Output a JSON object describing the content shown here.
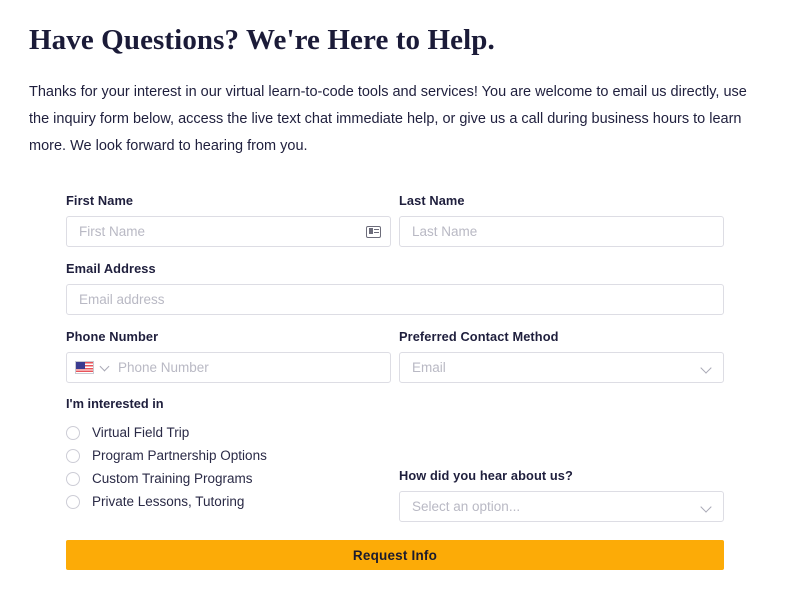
{
  "intro": {
    "title": "Have Questions? We're Here to Help.",
    "paragraph": "Thanks for your interest in our virtual learn-to-code tools and services! You are welcome to email us directly, use the inquiry form below, access the live text chat immediate help, or give us a call during business hours to learn more. We look forward to hearing from you."
  },
  "form": {
    "first_name": {
      "label": "First Name",
      "placeholder": "First Name",
      "value": "",
      "icon": "contact-card-icon"
    },
    "last_name": {
      "label": "Last Name",
      "placeholder": "Last Name",
      "value": ""
    },
    "email": {
      "label": "Email Address",
      "placeholder": "Email address",
      "value": ""
    },
    "phone": {
      "label": "Phone Number",
      "placeholder": "Phone Number",
      "value": "",
      "country_flag": "us-flag-icon",
      "country_chevron": "chevron-down-icon"
    },
    "contact_method": {
      "label": "Preferred Contact Method",
      "selected": "Email",
      "chevron": "chevron-down-icon"
    },
    "interested_in": {
      "label": "I'm interested in",
      "options": [
        "Virtual Field Trip",
        "Program Partnership Options",
        "Custom Training Programs",
        "Private Lessons, Tutoring"
      ],
      "selected": null
    },
    "hear_about_us": {
      "label": "How did you hear about us?",
      "selected": "Select an option...",
      "chevron": "chevron-down-icon"
    },
    "submit": {
      "label": "Request Info"
    }
  },
  "colors": {
    "accent": "#fcab07",
    "text_dark": "#1f1f3d",
    "placeholder": "#b9b9c4",
    "border": "#dddde4",
    "background": "#ffffff"
  }
}
